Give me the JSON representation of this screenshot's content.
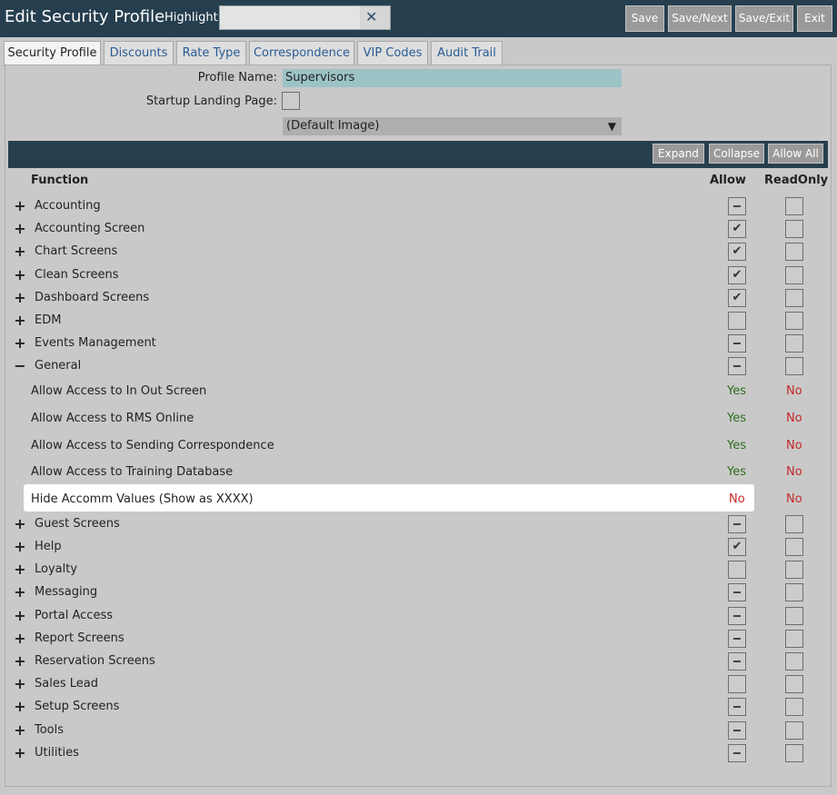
{
  "header": {
    "title": "Edit Security Profile",
    "highlight_label": "Highlight:",
    "highlight_value": "",
    "buttons": [
      "Save",
      "Save/Next",
      "Save/Exit",
      "Exit"
    ]
  },
  "tabs": [
    "Security Profile",
    "Discounts",
    "Rate Type",
    "Correspondence",
    "VIP Codes",
    "Audit Trail"
  ],
  "form": {
    "profile_name_label": "Profile Name:",
    "profile_name_value": "Supervisors",
    "startup_label": "Startup Landing Page:",
    "image_select": "(Default Image)"
  },
  "toolbar": {
    "expand": "Expand",
    "collapse": "Collapse",
    "allow_all": "Allow All"
  },
  "columns": {
    "function": "Function",
    "allow": "Allow",
    "readonly": "ReadOnly"
  },
  "functions": [
    {
      "label": "Accounting",
      "expander": "+",
      "allow": "partial",
      "readonly": "unchecked"
    },
    {
      "label": "Accounting Screen",
      "expander": "+",
      "allow": "checked",
      "readonly": "unchecked"
    },
    {
      "label": "Chart Screens",
      "expander": "+",
      "allow": "checked",
      "readonly": "unchecked"
    },
    {
      "label": "Clean Screens",
      "expander": "+",
      "allow": "checked",
      "readonly": "unchecked"
    },
    {
      "label": "Dashboard Screens",
      "expander": "+",
      "allow": "checked",
      "readonly": "unchecked"
    },
    {
      "label": "EDM",
      "expander": "+",
      "allow": "unchecked",
      "readonly": "unchecked"
    },
    {
      "label": "Events Management",
      "expander": "+",
      "allow": "partial",
      "readonly": "unchecked"
    },
    {
      "label": "General",
      "expander": "−",
      "allow": "partial",
      "readonly": "unchecked"
    }
  ],
  "permissions": [
    {
      "label": "Allow Access to In Out Screen",
      "allow": "Yes",
      "readonly": "No"
    },
    {
      "label": "Allow Access to RMS Online",
      "allow": "Yes",
      "readonly": "No"
    },
    {
      "label": "Allow Access to Sending Correspondence",
      "allow": "Yes",
      "readonly": "No"
    },
    {
      "label": "Allow Access to Training Database",
      "allow": "Yes",
      "readonly": "No"
    },
    {
      "label": "Hide Accomm Values (Show as XXXX)",
      "allow": "No",
      "readonly": "No"
    }
  ],
  "functions_after": [
    {
      "label": "Guest Screens",
      "expander": "+",
      "allow": "partial",
      "readonly": "unchecked"
    },
    {
      "label": "Help",
      "expander": "+",
      "allow": "checked",
      "readonly": "unchecked"
    },
    {
      "label": "Loyalty",
      "expander": "+",
      "allow": "unchecked",
      "readonly": "unchecked"
    },
    {
      "label": "Messaging",
      "expander": "+",
      "allow": "partial",
      "readonly": "unchecked"
    },
    {
      "label": "Portal Access",
      "expander": "+",
      "allow": "partial",
      "readonly": "unchecked"
    },
    {
      "label": "Report Screens",
      "expander": "+",
      "allow": "partial",
      "readonly": "unchecked"
    },
    {
      "label": "Reservation Screens",
      "expander": "+",
      "allow": "partial",
      "readonly": "unchecked"
    },
    {
      "label": "Sales Lead",
      "expander": "+",
      "allow": "unchecked",
      "readonly": "unchecked"
    },
    {
      "label": "Setup Screens",
      "expander": "+",
      "allow": "partial",
      "readonly": "unchecked"
    },
    {
      "label": "Tools",
      "expander": "+",
      "allow": "partial",
      "readonly": "unchecked"
    },
    {
      "label": "Utilities",
      "expander": "+",
      "allow": "partial",
      "readonly": "unchecked"
    }
  ],
  "colors": {
    "topbar": "#263f4f",
    "profile_name_bg": "#9cc3c6",
    "yes": "#2e6e1d",
    "no": "#c62828"
  }
}
